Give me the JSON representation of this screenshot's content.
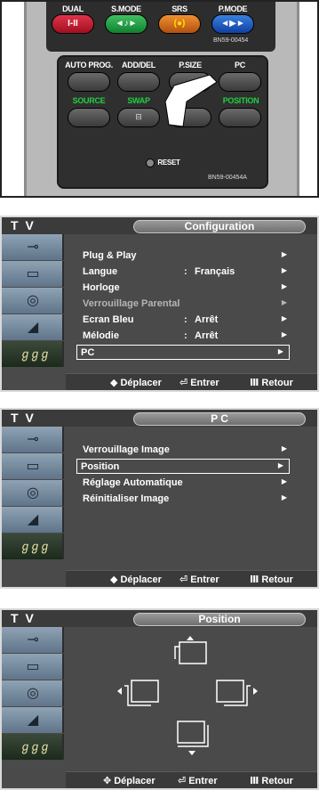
{
  "remote": {
    "top_buttons": [
      {
        "label": "DUAL",
        "face": "I-II",
        "color": "red"
      },
      {
        "label": "S.MODE",
        "face": "◄♪►",
        "color": "green"
      },
      {
        "label": "SRS",
        "face": "(●)",
        "color": "yellow"
      },
      {
        "label": "P.MODE",
        "face": "◄▶►",
        "color": "blue"
      }
    ],
    "top_model": "BN59-00454",
    "row1": [
      "AUTO PROG.",
      "ADD/DEL",
      "P.SIZE",
      "PC"
    ],
    "row2": [
      "SOURCE",
      "SWAP",
      "",
      "POSITION"
    ],
    "reset_label": "RESET",
    "bottom_model": "BN59-00454A"
  },
  "screens": [
    {
      "tv_label": "T V",
      "title": "Configuration",
      "items": [
        {
          "label": "Plug & Play",
          "value": "",
          "dim": false,
          "selected": false
        },
        {
          "label": "Langue",
          "value": "Français",
          "dim": false,
          "selected": false
        },
        {
          "label": "Horloge",
          "value": "",
          "dim": false,
          "selected": false
        },
        {
          "label": "Verrouillage Parental",
          "value": "",
          "dim": true,
          "selected": false
        },
        {
          "label": "Ecran Bleu",
          "value": "Arrêt",
          "dim": false,
          "selected": false
        },
        {
          "label": "Mélodie",
          "value": "Arrêt",
          "dim": false,
          "selected": false
        },
        {
          "label": "PC",
          "value": "",
          "dim": false,
          "selected": true
        }
      ],
      "footer": {
        "move": "Déplacer",
        "enter": "Entrer",
        "back": "Retour"
      }
    },
    {
      "tv_label": "T V",
      "title": "P C",
      "items": [
        {
          "label": "Verrouillage Image",
          "value": "",
          "dim": false,
          "selected": false
        },
        {
          "label": "Position",
          "value": "",
          "dim": false,
          "selected": true
        },
        {
          "label": "Réglage Automatique",
          "value": "",
          "dim": false,
          "selected": false
        },
        {
          "label": "Réinitialiser Image",
          "value": "",
          "dim": false,
          "selected": false
        }
      ],
      "footer": {
        "move": "Déplacer",
        "enter": "Entrer",
        "back": "Retour"
      }
    },
    {
      "tv_label": "T V",
      "title": "Position",
      "items": [],
      "footer": {
        "move": "Déplacer",
        "enter": "Entrer",
        "back": "Retour"
      }
    }
  ],
  "sidebar_icons": [
    "antenna-icon",
    "picture-icon",
    "sound-icon",
    "channel-icon",
    "setup-icon"
  ],
  "colors": {
    "screen_bg": "#4a4a4a",
    "header_bg": "#3b3b3b",
    "sidebar_blue": "#8fa3b5"
  }
}
